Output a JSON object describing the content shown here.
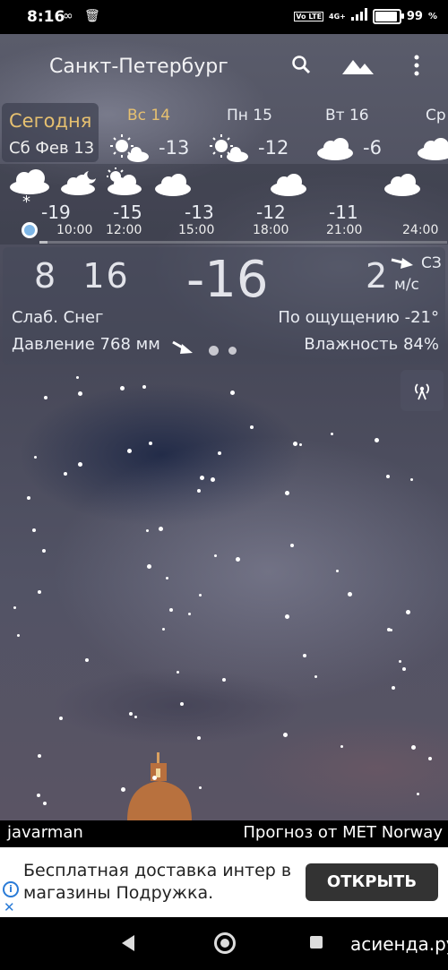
{
  "status_bar": {
    "time": "8:16",
    "icons": [
      "link-icon",
      "trash-icon"
    ],
    "network_label": "Vo LTE",
    "signal_label": "4G+",
    "battery_percent": "99",
    "battery_suffix": "%",
    "battery_level": 0.99
  },
  "app_bar": {
    "city": "Санкт-Петербург",
    "icons": [
      "search-icon",
      "mountains-icon",
      "more-vert-icon"
    ]
  },
  "days": {
    "today_label": "Сегодня",
    "today_date": "Сб Фев 13",
    "items": [
      {
        "name": "Вс 14",
        "temp": "-13",
        "icon": "sun-cloud-icon"
      },
      {
        "name": "Пн 15",
        "temp": "-12",
        "icon": "sun-cloud-icon"
      },
      {
        "name": "Вт 16",
        "temp": "-6",
        "icon": "cloud-icon"
      },
      {
        "name": "Ср",
        "temp": "",
        "icon": "cloud-icon"
      }
    ]
  },
  "hourly": {
    "items": [
      {
        "temp": "-19",
        "time": "",
        "icon": "snow-cloud-icon"
      },
      {
        "temp": "-15",
        "time": "10:00",
        "icon": "moon-cloud-icon"
      },
      {
        "temp": "-13",
        "time": "12:00",
        "icon": "sun-cloud-icon"
      },
      {
        "temp": "-12",
        "time": "15:00",
        "icon": "cloud-icon"
      },
      {
        "temp": "-11",
        "time": "18:00",
        "icon": "cloud-icon"
      },
      {
        "temp": "",
        "time": "21:00",
        "icon": "cloud-icon"
      },
      {
        "temp": "",
        "time": "24:00",
        "icon": "cloud-icon"
      }
    ],
    "progress_fraction": 0.02
  },
  "current": {
    "time_hour": "8",
    "time_min": "16",
    "temperature": "-16",
    "wind_speed": "2",
    "wind_dir": "СЗ",
    "wind_unit": "м/с",
    "condition": "Слаб. Снег",
    "feels_like": "По ощущению -21°",
    "pressure": "Давление 768 мм",
    "humidity": "Влажность 84%"
  },
  "footer": {
    "author": "javarman",
    "source": "Прогноз от MET Norway"
  },
  "ad": {
    "text": "Бесплатная доставка интер в магазины Подружка.",
    "button": "ОТКРЫТЬ"
  },
  "nav": {
    "watermark": "асиенда.ру"
  }
}
